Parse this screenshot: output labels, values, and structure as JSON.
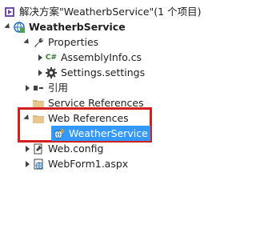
{
  "solution": {
    "label": "解决方案\"WeatherbService\"(1 个项目)"
  },
  "project": {
    "label": "WeatherbService"
  },
  "items": {
    "properties": "Properties",
    "assemblyinfo": "AssemblyInfo.cs",
    "settings": "Settings.settings",
    "references": "引用",
    "service_references": "Service References",
    "web_references": "Web References",
    "weather_service": "WeatherService",
    "web_config": "Web.config",
    "webform": "WebForm1.aspx"
  },
  "icons": {
    "csharp_badge": "C#"
  },
  "colors": {
    "selection": "#3399ff",
    "highlight_border": "#d21f1f"
  }
}
